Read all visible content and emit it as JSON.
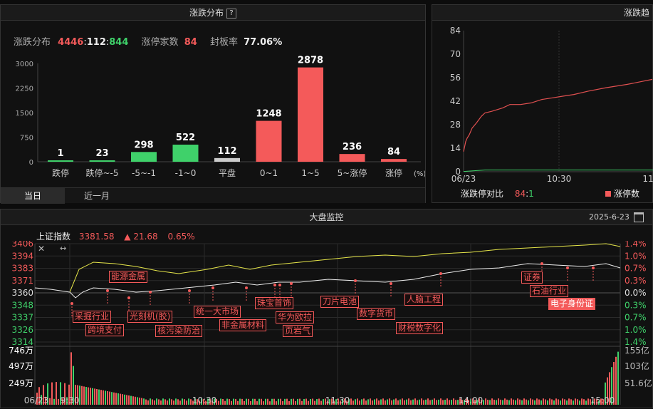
{
  "dist": {
    "title": "涨跌分布",
    "help": "?",
    "summary_label": "涨跌分布",
    "up": "4446",
    "flat": "112",
    "down": "844",
    "sep": ":",
    "limit_label": "涨停家数",
    "limit_value": "84",
    "seal_label": "封板率",
    "seal_value": "77.06%",
    "unit": "(%)",
    "tabs": [
      "当日",
      "近一月"
    ]
  },
  "trend": {
    "title": "涨跌趋",
    "ratio_label": "涨跌停对比",
    "ratio_up": "84",
    "ratio_sep": ":",
    "ratio_down": "1",
    "legend": "涨停数",
    "x_labels": [
      "06/23",
      "10:30",
      "11"
    ]
  },
  "monitor": {
    "title": "大盘监控",
    "date": "2025-6-23",
    "index_name": "上证指数",
    "index_value": "3381.58",
    "index_change": "▲ 21.68",
    "index_pct": "0.65%",
    "x_labels": [
      "06/23",
      "9:30",
      "10:30",
      "11:30",
      "14:00",
      "15:00"
    ],
    "vol_left": [
      "746万",
      "497万",
      "249万"
    ],
    "vol_right": [
      "155亿",
      "103亿",
      "51.6亿"
    ],
    "annotations": [
      {
        "text": "能源金属",
        "sel": false
      },
      {
        "text": "采掘行业",
        "sel": false
      },
      {
        "text": "跨境支付",
        "sel": false
      },
      {
        "text": "光刻机(胶)",
        "sel": false
      },
      {
        "text": "核污染防治",
        "sel": false
      },
      {
        "text": "统一大市场",
        "sel": false
      },
      {
        "text": "非金属材料",
        "sel": false
      },
      {
        "text": "珠宝首饰",
        "sel": false
      },
      {
        "text": "华为欧拉",
        "sel": false
      },
      {
        "text": "页岩气",
        "sel": false
      },
      {
        "text": "刀片电池",
        "sel": false
      },
      {
        "text": "数字货币",
        "sel": false
      },
      {
        "text": "人脑工程",
        "sel": false
      },
      {
        "text": "财税数字化",
        "sel": false
      },
      {
        "text": "证券",
        "sel": false
      },
      {
        "text": "石油行业",
        "sel": false
      },
      {
        "text": "电子身份证",
        "sel": true
      }
    ]
  },
  "colors": {
    "red": "#f45a5a",
    "green": "#3fd16a",
    "yellow": "#e6e64a",
    "white": "#eeeeee"
  },
  "chart_data": [
    {
      "type": "bar",
      "title": "涨跌分布",
      "categories": [
        "跌停",
        "跌停~-5",
        "-5~-1",
        "-1~0",
        "平盘",
        "0~1",
        "1~5",
        "5~涨停",
        "涨停"
      ],
      "values": [
        1,
        23,
        298,
        522,
        112,
        1248,
        2878,
        236,
        84
      ],
      "colors": [
        "#3fd16a",
        "#3fd16a",
        "#3fd16a",
        "#3fd16a",
        "#cccccc",
        "#f45a5a",
        "#f45a5a",
        "#f45a5a",
        "#f45a5a"
      ],
      "y_ticks": [
        "3000",
        "2250",
        "1500",
        "750",
        "0"
      ],
      "ylim": [
        0,
        3000
      ],
      "xlabel": "(%)"
    },
    {
      "type": "line",
      "title": "涨跌趋",
      "series": [
        {
          "name": "涨停数",
          "color": "#f45a5a"
        }
      ],
      "y_ticks": [
        "84",
        "70",
        "56",
        "42",
        "28",
        "14",
        "0"
      ],
      "ylim": [
        0,
        84
      ]
    },
    {
      "type": "line",
      "title": "上证指数",
      "y_left": [
        "3406",
        "3394",
        "3383",
        "3371",
        "3360",
        "3348",
        "3337",
        "3326",
        "3314"
      ],
      "y_right": [
        "1.4%",
        "1.0%",
        "0.7%",
        "0.3%",
        "0.0%",
        "0.3%",
        "0.7%",
        "1.0%",
        "1.4%"
      ],
      "ylim": [
        3314,
        3406
      ]
    }
  ]
}
